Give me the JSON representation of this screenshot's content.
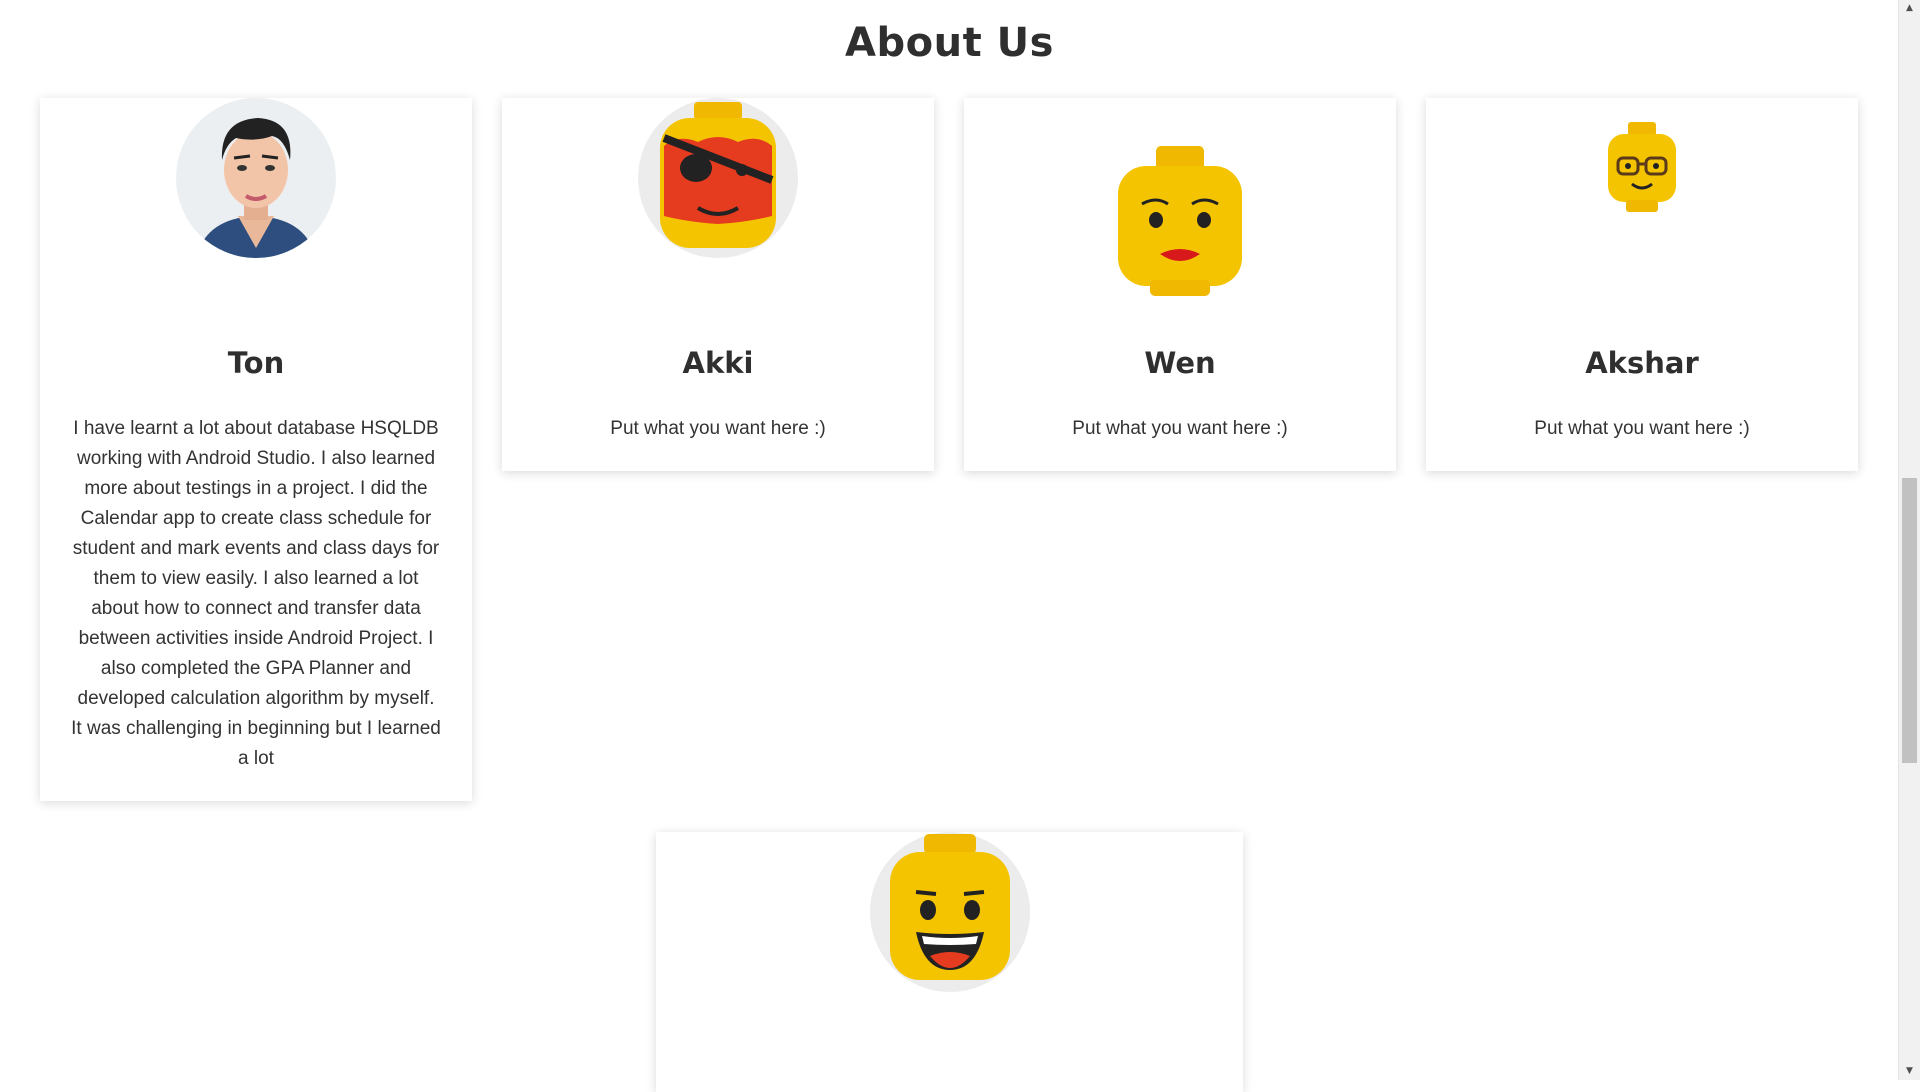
{
  "page": {
    "title": "About Us"
  },
  "members": [
    {
      "name": "Ton",
      "avatar": "cartoon-man-avatar-icon",
      "description": "I have learnt a lot about database HSQLDB working with Android Studio. I also learned more about testings in a project. I did the Calendar app to create class schedule for student and mark events and class days for them to view easily. I also learned a lot about how to connect and transfer data between activities inside Android Project. I also completed the GPA Planner and developed calculation algorithm by myself. It was challenging in beginning but I learned a lot"
    },
    {
      "name": "Akki",
      "avatar": "lego-pirate-head-icon",
      "description": "Put what you want here :)"
    },
    {
      "name": "Wen",
      "avatar": "lego-woman-head-icon",
      "description": "Put what you want here :)"
    },
    {
      "name": "Akshar",
      "avatar": "lego-glasses-head-icon",
      "description": "Put what you want here :)"
    },
    {
      "name": "",
      "avatar": "lego-smiling-head-icon",
      "description": ""
    }
  ],
  "scrollbar": {
    "up_icon": "scroll-up-arrow-icon",
    "down_icon": "scroll-down-arrow-icon",
    "up_glyph": "▲",
    "down_glyph": "▼"
  },
  "colors": {
    "lego_yellow": "#f5c400",
    "pirate_red": "#e53b1e",
    "card_shadow": "#d9d9d9"
  }
}
